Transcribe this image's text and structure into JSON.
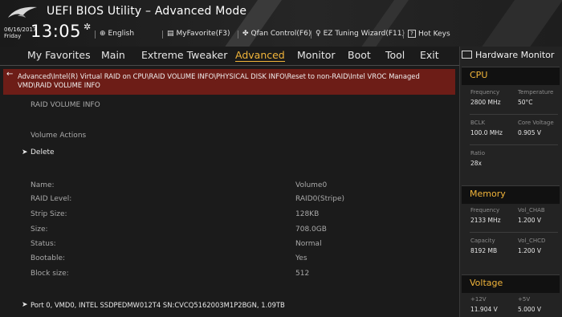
{
  "header": {
    "title": "UEFI BIOS Utility – Advanced Mode",
    "date": "06/16/2017",
    "day": "Friday",
    "time": "13:05",
    "toolbar": [
      {
        "icon": "globe-icon",
        "label": "English"
      },
      {
        "icon": "myfavorite-icon",
        "label": "MyFavorite(F3)"
      },
      {
        "icon": "fan-icon",
        "label": "Qfan Control(F6)"
      },
      {
        "icon": "bulb-icon",
        "label": "EZ Tuning Wizard(F11)"
      },
      {
        "icon": "hotkeys-icon",
        "label": "Hot Keys"
      }
    ]
  },
  "tabs": [
    "My Favorites",
    "Main",
    "Extreme Tweaker",
    "Advanced",
    "Monitor",
    "Boot",
    "Tool",
    "Exit"
  ],
  "active_tab": "Advanced",
  "path": "Advanced\\Intel(R) Virtual RAID on CPU\\RAID VOLUME INFO\\PHYSICAL DISK INFO\\Reset to non-RAID\\Intel VROC Managed VMD\\RAID VOLUME INFO",
  "main": {
    "section_title": "RAID VOLUME INFO",
    "actions_title": "Volume Actions",
    "delete_label": "Delete",
    "fields": [
      {
        "label": "Name:",
        "value": "Volume0"
      },
      {
        "label": "RAID Level:",
        "value": "RAID0(Stripe)"
      },
      {
        "label": "Strip Size:",
        "value": "128KB"
      },
      {
        "label": "Size:",
        "value": "708.0GB"
      },
      {
        "label": "Status:",
        "value": "Normal"
      },
      {
        "label": "Bootable:",
        "value": "Yes"
      },
      {
        "label": "Block size:",
        "value": "512"
      }
    ],
    "port_item": "Port 0, VMD0, INTEL SSDPEDMW012T4 SN:CVCQ5162003M1P2BGN, 1.09TB"
  },
  "hardware_monitor": {
    "title": "Hardware Monitor",
    "cpu": {
      "heading": "CPU",
      "frequency_label": "Frequency",
      "frequency": "2800 MHz",
      "temperature_label": "Temperature",
      "temperature": "50°C",
      "bclk_label": "BCLK",
      "bclk": "100.0 MHz",
      "core_voltage_label": "Core Voltage",
      "core_voltage": "0.905 V",
      "ratio_label": "Ratio",
      "ratio": "28x"
    },
    "memory": {
      "heading": "Memory",
      "frequency_label": "Frequency",
      "frequency": "2133 MHz",
      "vol_chab_label": "Vol_CHAB",
      "vol_chab": "1.200 V",
      "capacity_label": "Capacity",
      "capacity": "8192 MB",
      "vol_chcd_label": "Vol_CHCD",
      "vol_chcd": "1.200 V"
    },
    "voltage": {
      "heading": "Voltage",
      "v12_label": "+12V",
      "v12": "11.904 V",
      "v5_label": "+5V",
      "v5": "5.000 V"
    }
  },
  "colors": {
    "accent": "#f2b53a",
    "path_bar": "#6d1d17",
    "background": "#1b1b1b"
  }
}
